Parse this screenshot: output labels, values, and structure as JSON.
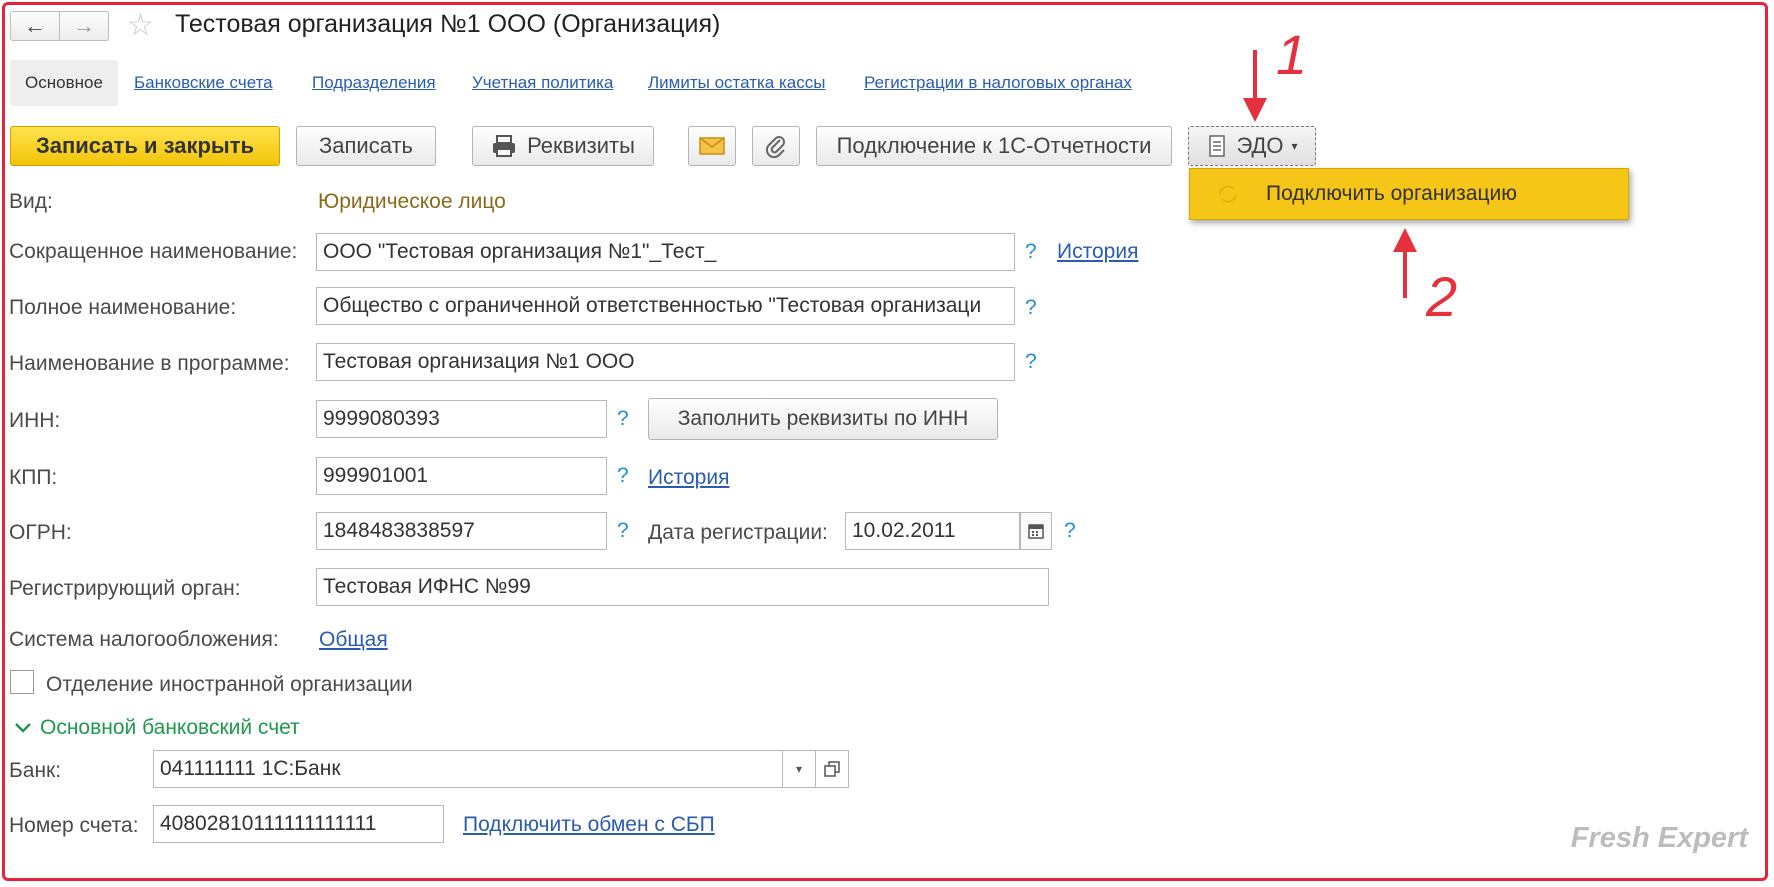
{
  "window": {
    "title": "Тестовая организация №1 ООО (Организация)",
    "back_icon": "←",
    "forward_icon": "→",
    "favorite_icon": "☆"
  },
  "tabs": [
    {
      "label": "Основное"
    },
    {
      "label": "Банковские счета"
    },
    {
      "label": "Подразделения"
    },
    {
      "label": "Учетная политика"
    },
    {
      "label": "Лимиты остатка кассы"
    },
    {
      "label": "Регистрации в налоговых органах"
    }
  ],
  "toolbar": {
    "save_close": "Записать и закрыть",
    "save": "Записать",
    "details": "Реквизиты",
    "connect_reporting": "Подключение к 1С-Отчетности",
    "edo": "ЭДО"
  },
  "edo_menu": {
    "item": "Подключить организацию"
  },
  "form": {
    "vid_label": "Вид:",
    "vid_value": "Юридическое лицо",
    "short_name_label": "Сокращенное наименование:",
    "short_name_value": "ООО \"Тестовая организация №1\"_Тест_",
    "full_name_label": "Полное наименование:",
    "full_name_value": "Общество с ограниченной ответственностью \"Тестовая организаци",
    "program_name_label": "Наименование в программе:",
    "program_name_value": "Тестовая организация №1 ООО",
    "inn_label": "ИНН:",
    "inn_value": "9999080393",
    "fill_by_inn": "Заполнить реквизиты по ИНН",
    "kpp_label": "КПП:",
    "kpp_value": "999901001",
    "ogrn_label": "ОГРН:",
    "ogrn_value": "1848483838597",
    "reg_date_label": "Дата регистрации:",
    "reg_date_value": "10.02.2011",
    "reg_org_label": "Регистрирующий орган:",
    "reg_org_value": "Тестовая ИФНС №99",
    "tax_system_label": "Система налогообложения:",
    "tax_system_value": "Общая",
    "foreign_branch_label": "Отделение иностранной организации",
    "history_link": "История",
    "help": "?"
  },
  "bank_section": {
    "title": "Основной банковский счет",
    "bank_label": "Банк:",
    "bank_value": "041111111 1С:Банк",
    "account_label": "Номер счета:",
    "account_value": "40802810111111111111",
    "sbp_link": "Подключить обмен с СБП"
  },
  "annotations": {
    "one": "1",
    "two": "2"
  },
  "watermark": "Fresh Expert",
  "colors": {
    "accent_yellow": "#f5c518",
    "link_blue": "#2a5cb0",
    "annotation_red": "#e3313d",
    "section_green": "#1f9a4c"
  }
}
